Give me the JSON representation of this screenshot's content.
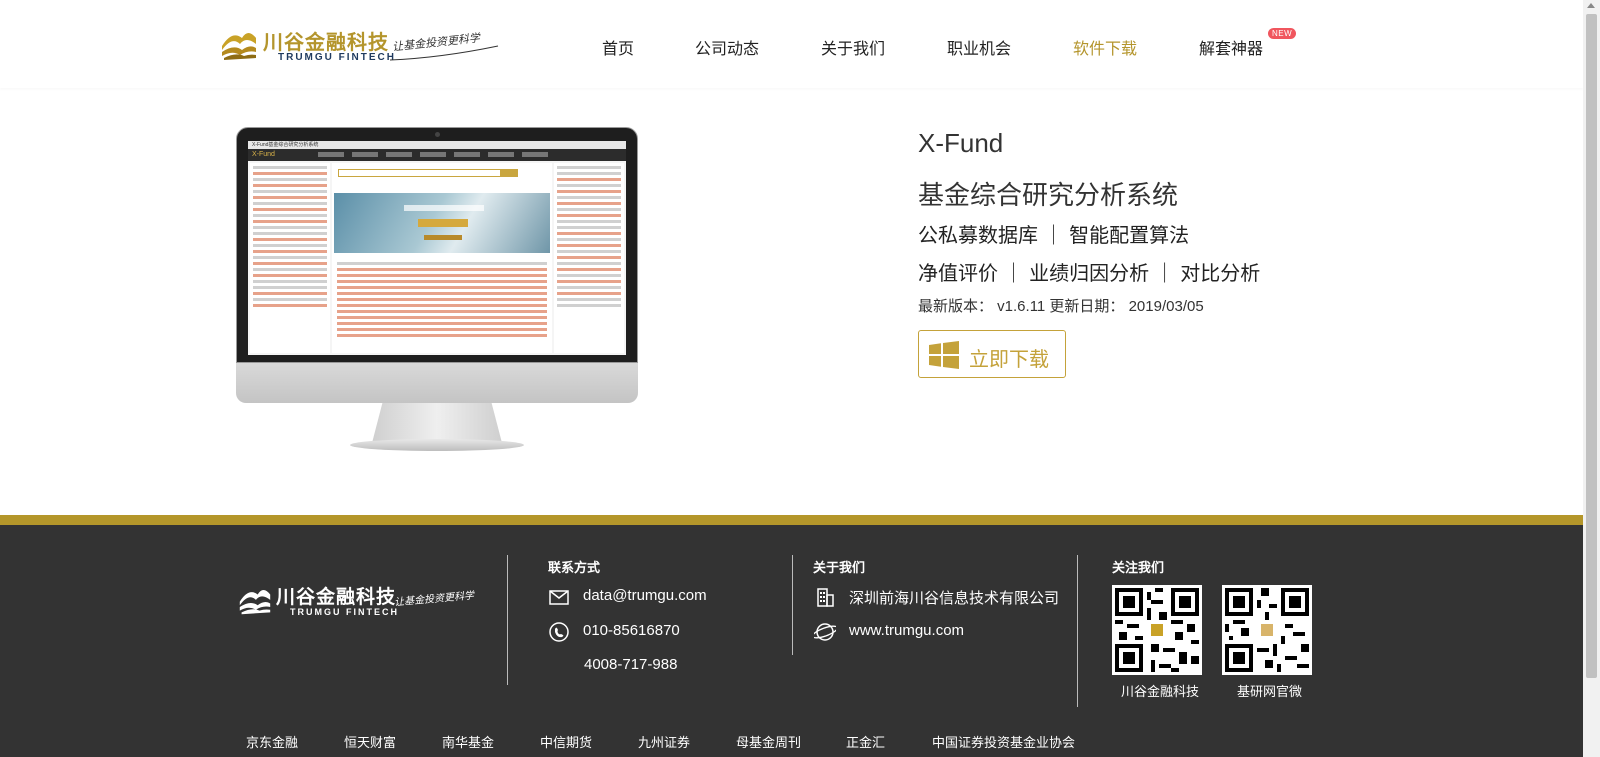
{
  "brand": {
    "name_cn": "川谷金融科技",
    "name_en": "TRUMGU FINTECH",
    "slogan": "让基金投资更科学"
  },
  "nav": {
    "items": [
      {
        "label": "首页"
      },
      {
        "label": "公司动态"
      },
      {
        "label": "关于我们"
      },
      {
        "label": "职业机会"
      },
      {
        "label": "软件下载",
        "active": true
      },
      {
        "label": "解套神器"
      }
    ],
    "new_badge": "NEW"
  },
  "product": {
    "title": "X-Fund",
    "subtitle": "基金综合研究分析系统",
    "features_1": "公私募数据库 ｜ 智能配置算法",
    "features_2": "净值评价 ｜ 业绩归因分析 ｜ 对比分析",
    "version_line": "最新版本： v1.6.11  更新日期： 2019/03/05",
    "download_label": "立即下载",
    "download_icon": "windows-icon"
  },
  "screen": {
    "app_name": "X-Fund",
    "window_title": "X-Fund基金综合研究分析系统"
  },
  "footer": {
    "contact": {
      "heading": "联系方式",
      "email": "data@trumgu.com",
      "phone1": "010-85616870",
      "phone2": "4008-717-988"
    },
    "about": {
      "heading": "关于我们",
      "company": "深圳前海川谷信息技术有限公司",
      "website": "www.trumgu.com"
    },
    "follow": {
      "heading": "关注我们",
      "qr1_label": "川谷金融科技",
      "qr2_label": "基研网官微"
    },
    "partners": [
      "京东金融",
      "恒天财富",
      "南华基金",
      "中信期货",
      "九州证券",
      "母基金周刊",
      "正金汇",
      "中国证券投资基金业协会"
    ]
  },
  "colors": {
    "accent": "#b4952c",
    "footer_bg": "#333333",
    "badge": "#f0565e"
  }
}
